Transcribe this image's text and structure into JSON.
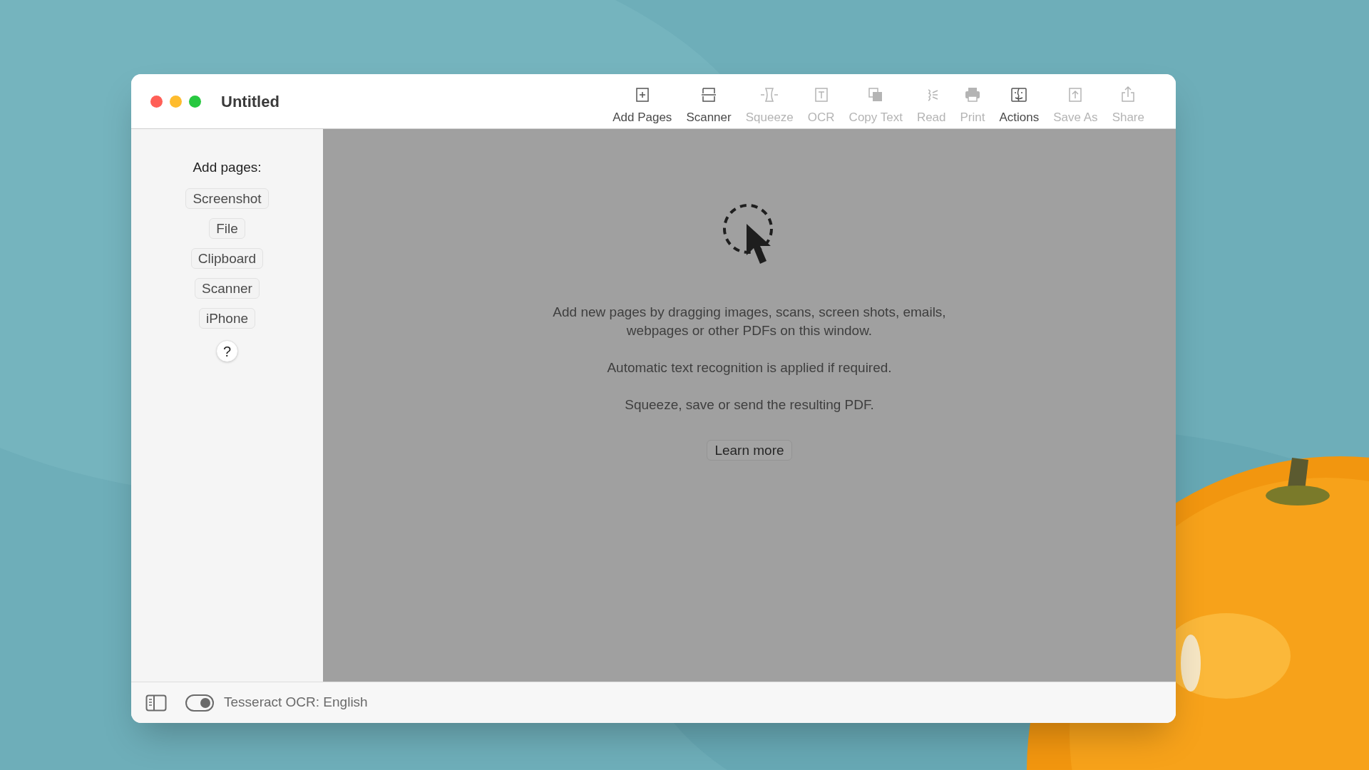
{
  "window": {
    "title": "Untitled"
  },
  "toolbar": [
    {
      "label": "Add Pages",
      "kind": "add",
      "disabled": false
    },
    {
      "label": "Scanner",
      "kind": "scanner",
      "disabled": false
    },
    {
      "label": "Squeeze",
      "kind": "squeeze",
      "disabled": true
    },
    {
      "label": "OCR",
      "kind": "ocr",
      "disabled": true
    },
    {
      "label": "Copy Text",
      "kind": "copy",
      "disabled": true
    },
    {
      "label": "Read",
      "kind": "read",
      "disabled": true
    },
    {
      "label": "Print",
      "kind": "print",
      "disabled": true
    },
    {
      "label": "Actions",
      "kind": "actions",
      "disabled": false
    },
    {
      "label": "Save As",
      "kind": "save",
      "disabled": true
    },
    {
      "label": "Share",
      "kind": "share",
      "disabled": true
    }
  ],
  "sidebar": {
    "heading": "Add pages:",
    "buttons": [
      "Screenshot",
      "File",
      "Clipboard",
      "Scanner",
      "iPhone"
    ],
    "help": "?"
  },
  "main": {
    "paragraphs": [
      "Add new pages by dragging images, scans, screen shots, emails, webpages or other PDFs on this window.",
      "Automatic text recognition is applied if required.",
      "Squeeze, save or send the resulting PDF."
    ],
    "button": "Learn more"
  },
  "status_bar": {
    "toggle": {
      "on": true
    },
    "label": "Tesseract OCR: English"
  }
}
